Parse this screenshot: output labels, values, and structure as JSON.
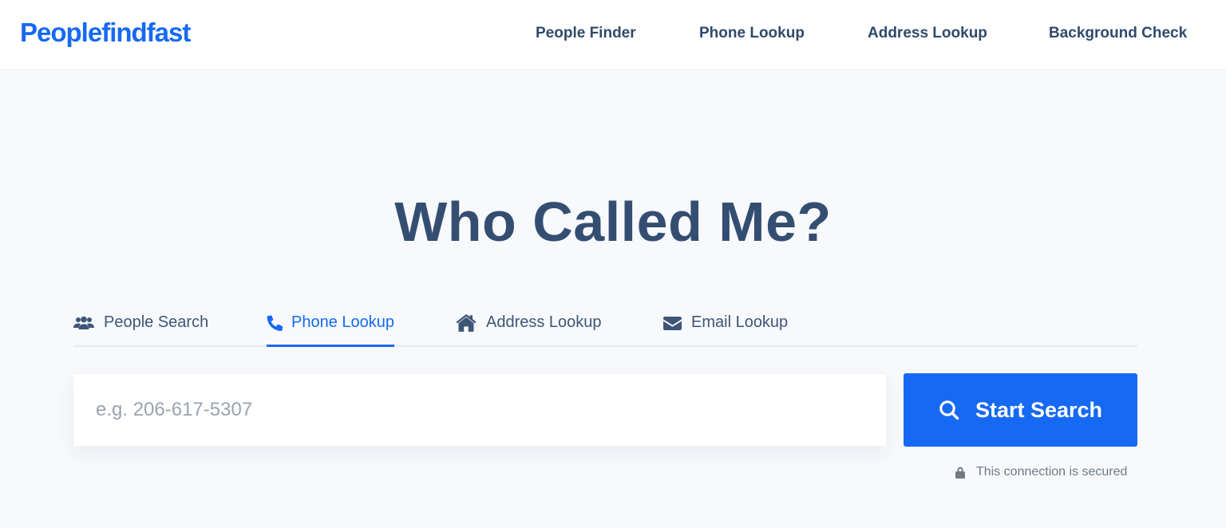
{
  "brand": {
    "logo_text": "Peoplefindfast",
    "accent_color": "#1669f2"
  },
  "nav": {
    "items": [
      {
        "label": "People Finder"
      },
      {
        "label": "Phone Lookup"
      },
      {
        "label": "Address Lookup"
      },
      {
        "label": "Background Check"
      }
    ]
  },
  "hero": {
    "title": "Who Called Me?"
  },
  "tabs": {
    "items": [
      {
        "label": "People Search",
        "icon": "users-icon",
        "active": false
      },
      {
        "label": "Phone Lookup",
        "icon": "phone-icon",
        "active": true
      },
      {
        "label": "Address Lookup",
        "icon": "home-icon",
        "active": false
      },
      {
        "label": "Email Lookup",
        "icon": "envelope-icon",
        "active": false
      }
    ]
  },
  "search": {
    "placeholder": "e.g. 206-617-5307",
    "value": "",
    "button_label": "Start Search",
    "button_icon": "search-icon"
  },
  "security": {
    "text": "This connection is secured",
    "icon": "lock-icon"
  }
}
